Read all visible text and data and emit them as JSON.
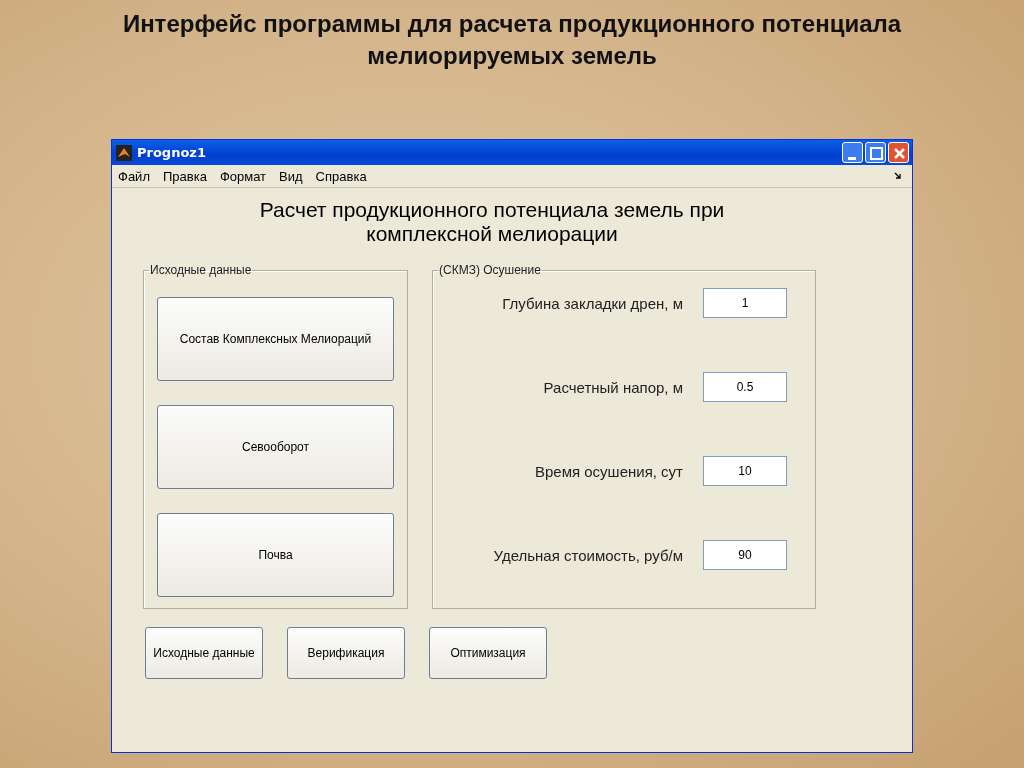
{
  "slide_title": "Интерфейс программы для расчета продукционного потенциала мелиорируемых земель",
  "window": {
    "title": "Prognoz1"
  },
  "menu": [
    "Файл",
    "Правка",
    "Формат",
    "Вид",
    "Справка"
  ],
  "heading": [
    "Расчет продукционного потенциала земель при",
    "комплексной мелиорации"
  ],
  "source_panel": {
    "title": "Исходные данные",
    "buttons": [
      "Состав Комплексных Мелиораций",
      "Севооборот",
      "Почва"
    ]
  },
  "drainage_panel": {
    "title": "(СКМЗ) Осушение",
    "fields": [
      {
        "label": "Глубина закладки дрен, м",
        "value": "1"
      },
      {
        "label": "Расчетный напор, м",
        "value": "0.5"
      },
      {
        "label": "Время осушения, сут",
        "value": "10"
      },
      {
        "label": "Удельная стоимость, руб/м",
        "value": "90"
      }
    ]
  },
  "bottom_buttons": [
    "Исходные данные",
    "Верификация",
    "Оптимизация"
  ]
}
